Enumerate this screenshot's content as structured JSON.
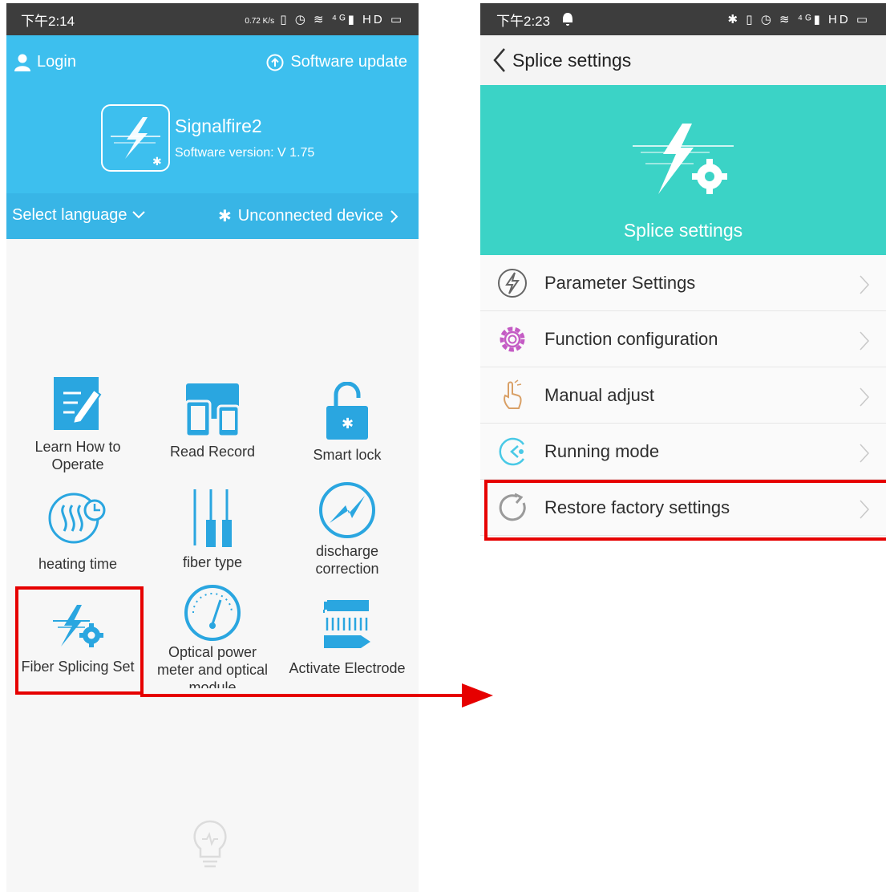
{
  "left": {
    "status": {
      "time": "下午2:14",
      "net_speed": "0.72 K/s",
      "icons": "▯ ◷ ≋ ⁴ᴳ▮ HD ▭"
    },
    "login_label": "Login",
    "update_label": "Software update",
    "brand_name": "Signalfire2",
    "version": "Software version: V 1.75",
    "language_label": "Select language",
    "device_label": "Unconnected device",
    "grid": [
      {
        "label": "Learn How to Operate"
      },
      {
        "label": "Read Record"
      },
      {
        "label": "Smart lock"
      },
      {
        "label": "heating time"
      },
      {
        "label": "fiber type"
      },
      {
        "label": "discharge correction"
      },
      {
        "label": "Fiber Splicing Set"
      },
      {
        "label": "Optical power meter and optical module"
      },
      {
        "label": "Activate Electrode"
      }
    ]
  },
  "right": {
    "status": {
      "time": "下午2:23",
      "icons": "✱ ▯ ◷ ≋ ⁴ᴳ▮ HD ▭"
    },
    "back_title": "Splice settings",
    "banner_title": "Splice settings",
    "menu": [
      {
        "label": "Parameter Settings",
        "icon": "lightning-circle-icon"
      },
      {
        "label": "Function configuration",
        "icon": "gear-icon"
      },
      {
        "label": "Manual adjust",
        "icon": "hand-icon"
      },
      {
        "label": "Running mode",
        "icon": "running-mode-icon"
      },
      {
        "label": "Restore factory settings",
        "icon": "restore-icon"
      }
    ]
  },
  "colors": {
    "header_blue": "#3dbfee",
    "banner_teal": "#3bd3c6",
    "icon_blue": "#2aa6e0",
    "highlight_red": "#e60000"
  }
}
